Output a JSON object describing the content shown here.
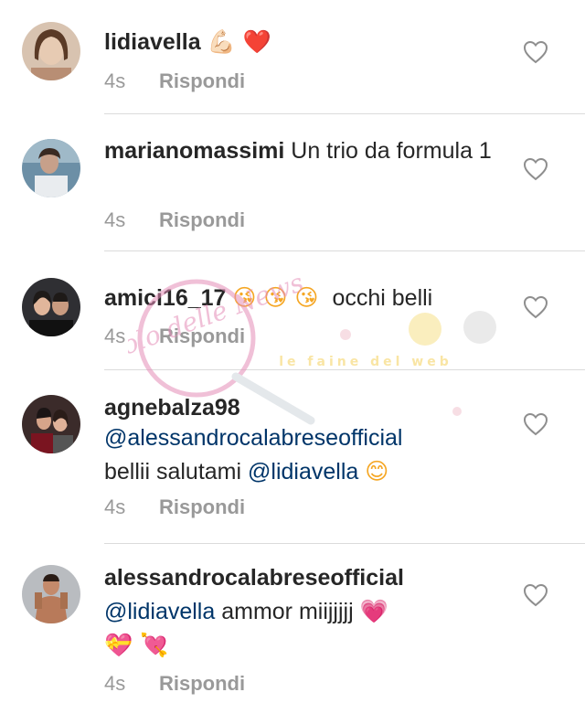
{
  "comments": [
    {
      "username": "lidiavella",
      "text_parts": [],
      "emoji": "💪🏻 ❤️",
      "time": "4s",
      "reply_label": "Rispondi"
    },
    {
      "username": "marianomassimi",
      "text": "Un trio da formula 1",
      "time": "4s",
      "reply_label": "Rispondi"
    },
    {
      "username": "amici16_17",
      "emoji": "😘 😘 😘",
      "text": "occhi belli",
      "time": "4s",
      "reply_label": "Rispondi"
    },
    {
      "username": "agnebalza98",
      "mention1": "@alessandrocalabreseofficial",
      "text": "bellii salutami",
      "mention2": "@lidiavella",
      "emoji": "😊",
      "time": "4s",
      "reply_label": "Rispondi"
    },
    {
      "username": "alessandrocalabreseofficial",
      "mention": "@lidiavella",
      "text": "ammor  miijjjjj",
      "emoji1": "💗",
      "emoji2": "💝 💘",
      "time": "4s",
      "reply_label": "Rispondi"
    }
  ],
  "watermark": {
    "title": "Vicolo delle News",
    "tagline": "le faine del web"
  },
  "icons": {
    "like": "heart-outline-icon"
  },
  "colors": {
    "mention": "#003569",
    "meta": "#999999",
    "divider": "#dbdbdb"
  }
}
